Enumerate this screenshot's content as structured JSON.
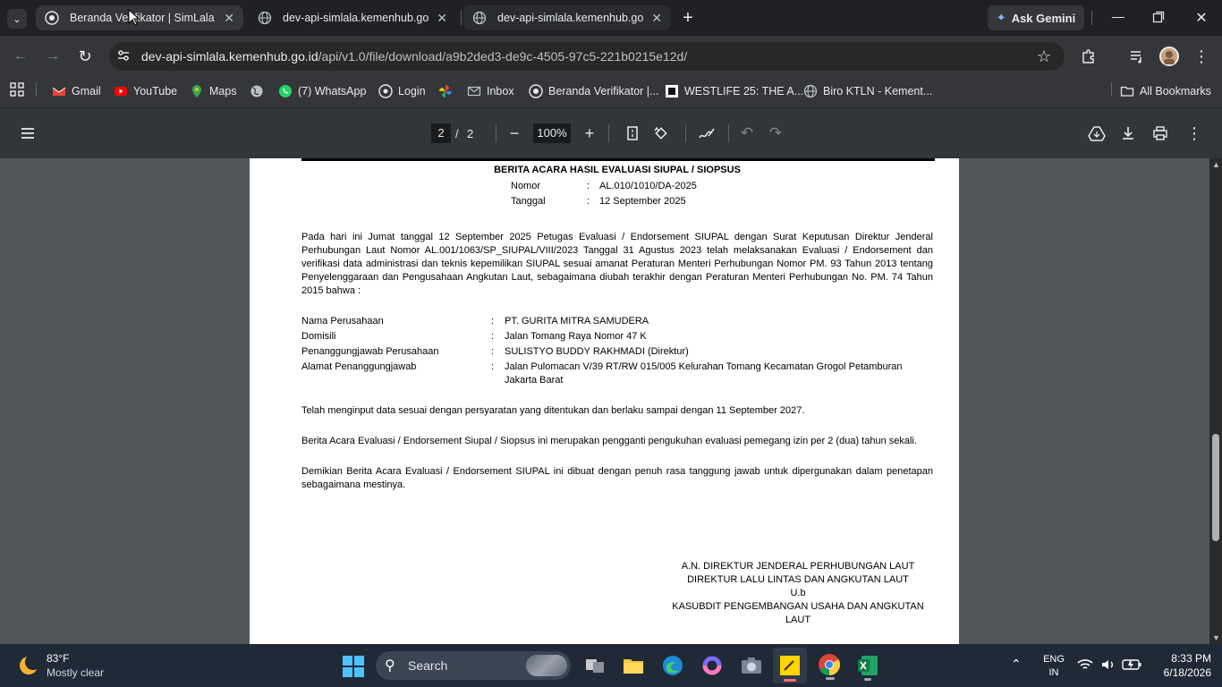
{
  "tabs": [
    {
      "title": "Beranda Verifikator | SimLala",
      "active": true
    },
    {
      "title": "dev-api-simlala.kemenhub.go.id",
      "active": false
    },
    {
      "title": "dev-api-simlala.kemenhub.go.id",
      "active": false
    }
  ],
  "ask_gemini": "Ask Gemini",
  "url": {
    "host": "dev-api-simlala.kemenhub.go.id",
    "path": "/api/v1.0/file/download/a9b2ded3-de9c-4505-97c5-221b0215e12d/"
  },
  "bookmarks": [
    {
      "label": "Gmail",
      "icon": "gmail-icon"
    },
    {
      "label": "YouTube",
      "icon": "youtube-icon"
    },
    {
      "label": "Maps",
      "icon": "maps-icon"
    },
    {
      "label": "",
      "icon": "globe-icon"
    },
    {
      "label": "(7) WhatsApp",
      "icon": "whatsapp-icon"
    },
    {
      "label": "Login",
      "icon": "login-icon"
    },
    {
      "label": "",
      "icon": "pinwheel-icon"
    },
    {
      "label": "Inbox",
      "icon": "mail-icon"
    },
    {
      "label": "Beranda Verifikator |...",
      "icon": "simlala-icon"
    },
    {
      "label": "WESTLIFE 25: THE A...",
      "icon": "westlife-icon"
    },
    {
      "label": "Biro KTLN - Kement...",
      "icon": "globe-icon"
    }
  ],
  "all_bookmarks": "All Bookmarks",
  "pdf": {
    "page_current": "2",
    "page_sep": "/",
    "page_total": "2",
    "zoom": "100%"
  },
  "doc": {
    "title": "BERITA ACARA HASIL EVALUASI SIUPAL / SIOPSUS",
    "nomor_label": "Nomor",
    "nomor_value": "AL.010/1010/DA-2025",
    "tanggal_label": "Tanggal",
    "tanggal_value": "12 September 2025",
    "colon": ":",
    "para1": "Pada hari ini Jumat tanggal 12 September 2025 Petugas Evaluasi / Endorsement SIUPAL dengan Surat Keputusan Direktur Jenderal Perhubungan Laut Nomor  AL.001/1063/SP_SIUPAL/VIII/2023 Tanggal  31 Agustus 2023 telah melaksanakan Evaluasi / Endorsement dan verifikasi data administrasi dan teknis kepemilikan SIUPAL sesuai amanat Peraturan Menteri Perhubungan Nomor PM. 93 Tahun 2013 tentang Penyelenggaraan dan Pengusahaan Angkutan Laut, sebagaimana diubah terakhir dengan Peraturan Menteri Perhubungan No. PM. 74 Tahun 2015 bahwa :",
    "fields": [
      {
        "label": "Nama Perusahaan",
        "value": "PT. GURITA MITRA SAMUDERA"
      },
      {
        "label": "Domisili",
        "value": "Jalan Tomang Raya Nomor 47 K"
      },
      {
        "label": "Penanggungjawab Perusahaan",
        "value": "SULISTYO BUDDY RAKHMADI (Direktur)"
      },
      {
        "label": "Alamat Penanggungjawab",
        "value": "Jalan Pulomacan V/39 RT/RW 015/005 Kelurahan Tomang Kecamatan Grogol Petamburan Jakarta Barat"
      }
    ],
    "para2": "Telah menginput data sesuai dengan persyaratan yang ditentukan dan berlaku sampai dengan 11 September 2027.",
    "para3": "Berita Acara Evaluasi / Endorsement Siupal / Siopsus ini merupakan pengganti pengukuhan evaluasi pemegang izin per 2 (dua) tahun sekali.",
    "para4": "Demikian Berita Acara Evaluasi / Endorsement SIUPAL ini dibuat dengan penuh rasa tanggung jawab untuk dipergunakan dalam penetapan sebagaimana mestinya.",
    "sig1": "A.N. DIREKTUR JENDERAL PERHUBUNGAN LAUT",
    "sig2": "DIREKTUR LALU LINTAS DAN ANGKUTAN LAUT",
    "sig3": "U.b",
    "sig4": "KASUBDIT PENGEMBANGAN USAHA DAN ANGKUTAN LAUT"
  },
  "taskbar": {
    "weather_temp": "83°F",
    "weather_desc": "Mostly clear",
    "search": "Search",
    "lang1": "ENG",
    "lang2": "IN",
    "time": "8:33 PM",
    "date": "6/18/2026"
  },
  "colors": {
    "chrome_dark": "#202124",
    "toolbar": "#35363a",
    "pdf_bg": "#525659",
    "pdf_bar": "#323639"
  }
}
